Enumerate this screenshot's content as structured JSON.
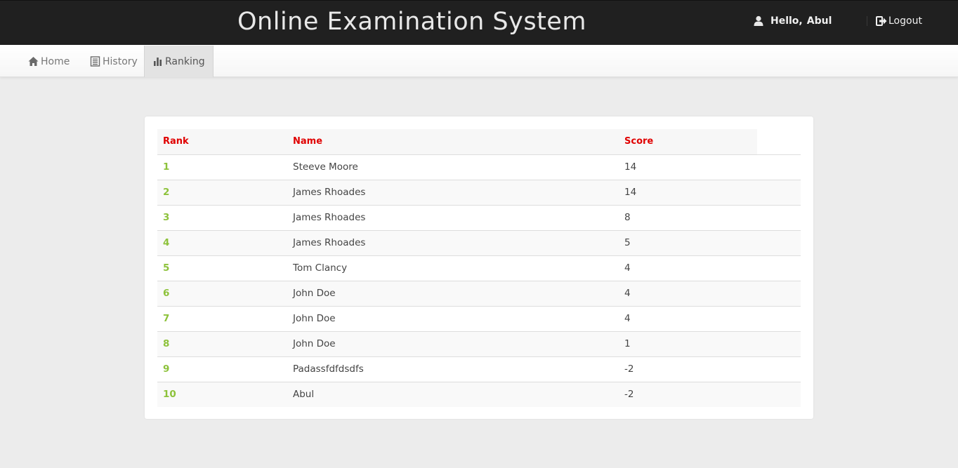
{
  "header": {
    "title": "Online Examination System",
    "greeting": "Hello,",
    "username": "Abul",
    "user_icon": "user-icon",
    "logout_label": "Logout",
    "logout_icon": "logout-icon"
  },
  "nav": {
    "items": [
      {
        "label": "Home",
        "icon": "home-icon"
      },
      {
        "label": "History",
        "icon": "list-icon"
      },
      {
        "label": "Ranking",
        "icon": "bar-chart-icon",
        "active": true
      }
    ]
  },
  "ranking": {
    "columns": [
      "Rank",
      "Name",
      "Score"
    ],
    "rows": [
      {
        "rank": "1",
        "name": "Steeve Moore",
        "score": "14"
      },
      {
        "rank": "2",
        "name": "James Rhoades",
        "score": "14"
      },
      {
        "rank": "3",
        "name": "James Rhoades",
        "score": "8"
      },
      {
        "rank": "4",
        "name": "James Rhoades",
        "score": "5"
      },
      {
        "rank": "5",
        "name": "Tom Clancy",
        "score": "4"
      },
      {
        "rank": "6",
        "name": "John Doe",
        "score": "4"
      },
      {
        "rank": "7",
        "name": "John Doe",
        "score": "4"
      },
      {
        "rank": "8",
        "name": "John Doe",
        "score": "1"
      },
      {
        "rank": "9",
        "name": "Padassfdfdsdfs",
        "score": "-2"
      },
      {
        "rank": "10",
        "name": "Abul",
        "score": "-2"
      }
    ]
  },
  "colors": {
    "header_bg": "#202020",
    "heading_red": "#e00000",
    "rank_green": "#8dc23b",
    "page_bg": "#ececec"
  }
}
